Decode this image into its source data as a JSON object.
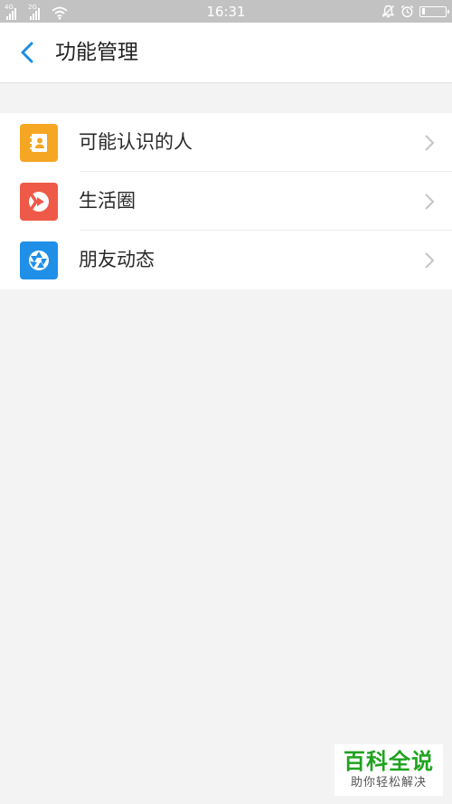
{
  "status_bar": {
    "network_1": "4G",
    "network_2": "2G",
    "time": "16:31",
    "battery_level": 0.15,
    "icons": [
      "signal-icon",
      "wifi-icon",
      "notification-bell-icon",
      "alarm-clock-icon",
      "battery-icon"
    ]
  },
  "header": {
    "title": "功能管理",
    "back_icon": "chevron-left-icon"
  },
  "features": [
    {
      "label": "可能认识的人",
      "icon": "contacts-book-icon",
      "icon_color": "#f5a623"
    },
    {
      "label": "生活圈",
      "icon": "play-circle-icon",
      "icon_color": "#ee5a47"
    },
    {
      "label": "朋友动态",
      "icon": "aperture-icon",
      "icon_color": "#1f8fe8"
    }
  ],
  "watermark": {
    "title": "百科全说",
    "subtitle": "助你轻松解决"
  },
  "colors": {
    "accent": "#1a8de0",
    "background": "#f3f3f3",
    "status_bar": "#c2c2c2"
  }
}
